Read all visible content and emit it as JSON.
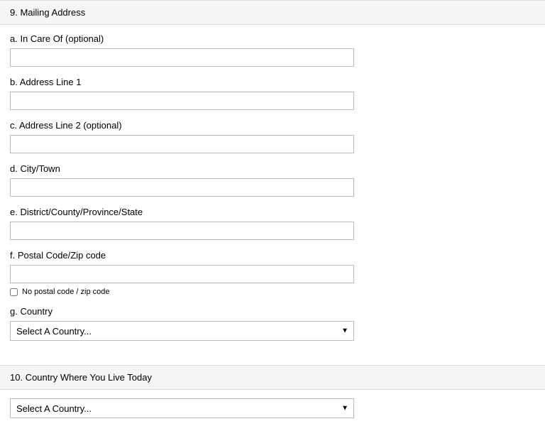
{
  "section9": {
    "title": "9. Mailing Address",
    "fields": {
      "in_care_of": {
        "label": "a. In Care Of (optional)",
        "value": ""
      },
      "address_line_1": {
        "label": "b. Address Line 1",
        "value": ""
      },
      "address_line_2": {
        "label": "c. Address Line 2 (optional)",
        "value": ""
      },
      "city_town": {
        "label": "d. City/Town",
        "value": ""
      },
      "district": {
        "label": "e. District/County/Province/State",
        "value": ""
      },
      "postal_code": {
        "label": "f. Postal Code/Zip code",
        "value": ""
      },
      "no_postal_checkbox": {
        "label": "No postal code / zip code"
      },
      "country": {
        "label": "g. Country",
        "placeholder": "Select A Country..."
      }
    }
  },
  "section10": {
    "title": "10. Country Where You Live Today",
    "country": {
      "placeholder": "Select A Country..."
    }
  }
}
